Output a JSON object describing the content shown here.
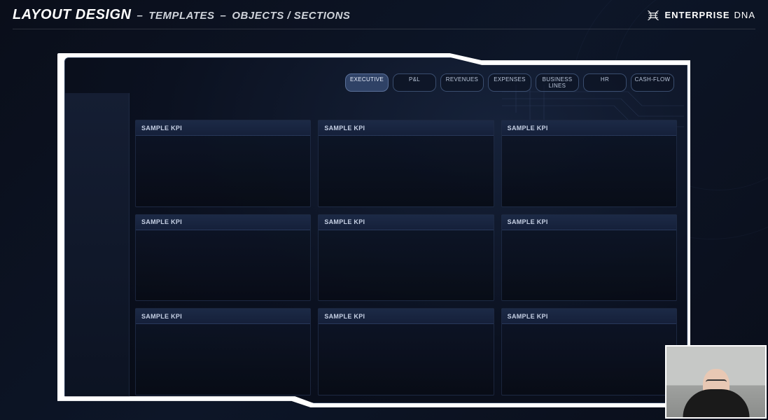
{
  "header": {
    "title_main": "LAYOUT DESIGN",
    "sep1": "–",
    "title_sub1": "TEMPLATES",
    "sep2": "–",
    "title_sub2": "OBJECTS / SECTIONS"
  },
  "brand": {
    "name_bold": "ENTERPRISE",
    "name_thin": "DNA"
  },
  "tabs": [
    {
      "label": "EXECUTIVE",
      "active": true
    },
    {
      "label": "P&L",
      "active": false
    },
    {
      "label": "REVENUES",
      "active": false
    },
    {
      "label": "EXPENSES",
      "active": false
    },
    {
      "label": "BUSINESS LINES",
      "active": false
    },
    {
      "label": "HR",
      "active": false
    },
    {
      "label": "CASH-FLOW",
      "active": false
    }
  ],
  "cards": [
    {
      "title": "SAMPLE KPI"
    },
    {
      "title": "SAMPLE KPI"
    },
    {
      "title": "SAMPLE KPI"
    },
    {
      "title": "SAMPLE KPI"
    },
    {
      "title": "SAMPLE KPI"
    },
    {
      "title": "SAMPLE KPI"
    },
    {
      "title": "SAMPLE KPI"
    },
    {
      "title": "SAMPLE KPI"
    },
    {
      "title": "SAMPLE KPI"
    }
  ]
}
